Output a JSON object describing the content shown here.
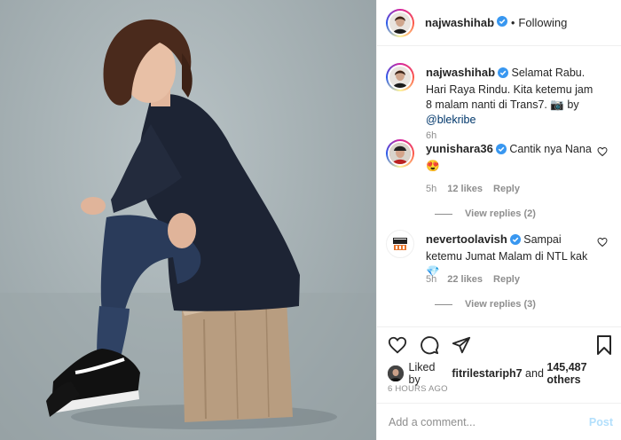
{
  "header": {
    "username": "najwashihab",
    "separator": "•",
    "follow_status": "Following"
  },
  "caption": {
    "username": "najwashihab",
    "text": "Selamat Rabu. Hari Raya Rindu. Kita ketemu jam 8 malam nanti di Trans7.",
    "by_label": "by",
    "mention": "@blekribe",
    "time": "6h"
  },
  "comments": [
    {
      "username": "yunishara36",
      "text": "Cantik nya Nana",
      "emoji": "😍",
      "time": "5h",
      "likes": "12 likes",
      "reply_label": "Reply",
      "view_replies": "View replies (2)"
    },
    {
      "username": "nevertoolavish",
      "text": "Sampai ketemu Jumat Malam di NTL kak",
      "emoji": "💎",
      "time": "5h",
      "likes": "22 likes",
      "reply_label": "Reply",
      "view_replies": "View replies (3)"
    }
  ],
  "likes": {
    "prefix": "Liked by",
    "user": "fitrilestariph7",
    "conj": "and",
    "others": "145,487 others"
  },
  "timestamp": "6 HOURS AGO",
  "add_comment": {
    "placeholder": "Add a comment...",
    "post_label": "Post"
  },
  "colors": {
    "verified": "#3897f0",
    "link": "#00376b",
    "muted": "#8e8e8e",
    "post_disabled": "#b2dffc"
  },
  "icons": [
    "verified-icon",
    "heart-icon",
    "comment-icon",
    "share-icon",
    "bookmark-icon"
  ]
}
